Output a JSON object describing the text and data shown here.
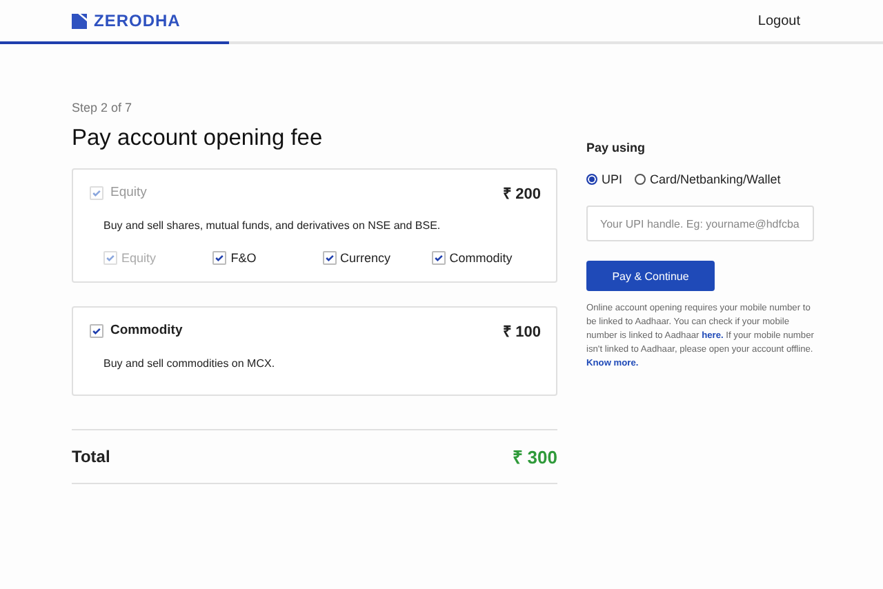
{
  "header": {
    "logo": "ZERODHA",
    "logout": "Logout",
    "progress": {
      "level": 0.26
    }
  },
  "step": "Step 2 of 7",
  "title": "Pay account opening fee",
  "segments": [
    {
      "label": "Equity",
      "checked": true,
      "disabled": true,
      "price": "₹ 200",
      "description": "Buy and sell shares, mutual funds, and derivatives on NSE and BSE.",
      "options": [
        {
          "label": "Equity",
          "checked": true,
          "disabled": true
        },
        {
          "label": "F&O",
          "checked": true,
          "disabled": false
        },
        {
          "label": "Currency",
          "checked": true,
          "disabled": false
        },
        {
          "label": "Commodity",
          "checked": true,
          "disabled": false
        }
      ]
    },
    {
      "label": "Commodity",
      "checked": true,
      "disabled": false,
      "price": "₹ 100",
      "description": "Buy and sell commodities on MCX."
    }
  ],
  "total": {
    "label": "Total",
    "amount": "₹ 300"
  },
  "payment": {
    "heading": "Pay using",
    "methods": [
      {
        "label": "UPI",
        "selected": true
      },
      {
        "label": "Card/Netbanking/Wallet",
        "selected": false
      }
    ],
    "placeholder": "Your UPI handle. Eg: yourname@hdfcba",
    "button": "Pay & Continue",
    "note": [
      {
        "kind": "text",
        "text": "Online account opening requires your mobile number to be linked to Aadhaar. You can check if your mobile number is linked to Aadhaar "
      },
      {
        "kind": "link",
        "text": "here."
      },
      {
        "kind": "text",
        "text": " If your mobile number isn't linked to Aadhaar, please open your account offline. "
      },
      {
        "kind": "link",
        "text": "Know more."
      }
    ]
  }
}
